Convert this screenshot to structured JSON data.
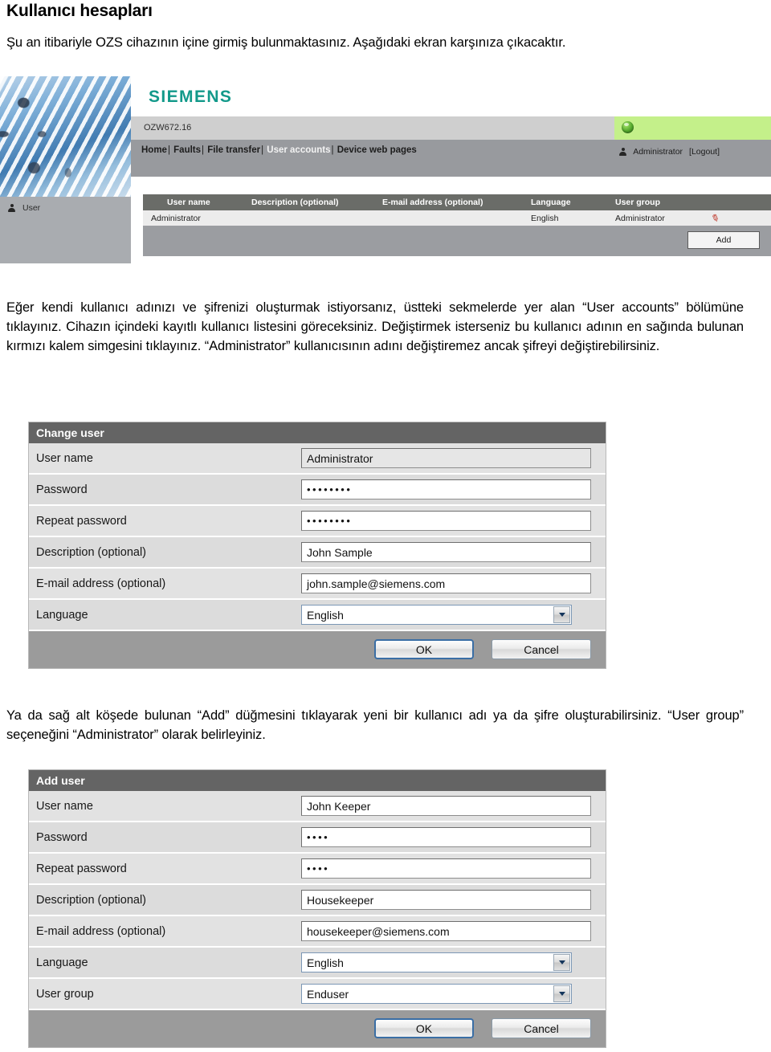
{
  "document": {
    "title": "Kullanıcı hesapları",
    "intro_paragraph": "Şu an itibariyle OZS cihazının içine girmiş bulunmaktasınız. Aşağıdaki ekran karşınıza çıkacaktır.",
    "middle_paragraph": "Eğer kendi kullanıcı adınızı ve şifrenizi oluşturmak istiyorsanız, üstteki sekmelerde yer alan “User accounts” bölümüne tıklayınız. Cihazın içindeki kayıtlı kullanıcı listesini göreceksiniz. Değiştirmek isterseniz bu kullanıcı adının en sağında bulunan kırmızı kalem simgesini tıklayınız. “Administrator” kullanıcısının adını değiştiremez ancak şifreyi değiştirebilirsiniz.",
    "add_paragraph": "Ya da sağ alt köşede bulunan “Add” düğmesini tıklayarak yeni bir kullanıcı adı ya da şifre oluşturabilirsiniz. “User group” seçeneğini “Administrator” olarak belirleyiniz."
  },
  "web_screenshot": {
    "brand": "SIEMENS",
    "device_name": "OZW672.16",
    "status_led": "green-status-led",
    "nav": {
      "items": [
        {
          "label": "Home",
          "active": false
        },
        {
          "label": "Faults",
          "active": false
        },
        {
          "label": "File transfer",
          "active": false
        },
        {
          "label": "User accounts",
          "active": true
        },
        {
          "label": "Device web pages",
          "active": false
        }
      ],
      "separator": "|"
    },
    "session": {
      "user": "Administrator",
      "logout": "[Logout]"
    },
    "sidebar": {
      "label": "User"
    },
    "users_table": {
      "headers": [
        "User name",
        "Description (optional)",
        "E-mail address (optional)",
        "Language",
        "User group"
      ],
      "rows": [
        {
          "user_name": "Administrator",
          "description": "",
          "email": "",
          "language": "English",
          "user_group": "Administrator",
          "edit_icon": "red-pen-icon"
        }
      ],
      "add_button": "Add"
    }
  },
  "change_user_dialog": {
    "title": "Change user",
    "fields": [
      {
        "label": "User name",
        "value": "Administrator",
        "type": "text",
        "readonly": true
      },
      {
        "label": "Password",
        "value": "••••••••",
        "type": "password",
        "readonly": false
      },
      {
        "label": "Repeat password",
        "value": "••••••••",
        "type": "password",
        "readonly": false
      },
      {
        "label": "Description (optional)",
        "value": "John Sample",
        "type": "text",
        "readonly": false
      },
      {
        "label": "E-mail address (optional)",
        "value": "john.sample@siemens.com",
        "type": "text",
        "readonly": false
      },
      {
        "label": "Language",
        "value": "English",
        "type": "select",
        "readonly": false
      }
    ],
    "ok_label": "OK",
    "cancel_label": "Cancel"
  },
  "add_user_dialog": {
    "title": "Add user",
    "fields": [
      {
        "label": "User name",
        "value": "John Keeper",
        "type": "text",
        "readonly": false
      },
      {
        "label": "Password",
        "value": "••••",
        "type": "password",
        "readonly": false
      },
      {
        "label": "Repeat password",
        "value": "••••",
        "type": "password",
        "readonly": false
      },
      {
        "label": "Description (optional)",
        "value": "Housekeeper",
        "type": "text",
        "readonly": false
      },
      {
        "label": "E-mail address (optional)",
        "value": "housekeeper@siemens.com",
        "type": "text",
        "readonly": false
      },
      {
        "label": "Language",
        "value": "English",
        "type": "select",
        "readonly": false
      },
      {
        "label": "User group",
        "value": "Enduser",
        "type": "select",
        "readonly": false
      }
    ],
    "ok_label": "OK",
    "cancel_label": "Cancel"
  },
  "colors": {
    "siemens_teal": "#12998a",
    "status_green": "#c4f08a",
    "dialog_title_gray": "#646464",
    "table_header_gray": "#6a6c68",
    "pen_red": "#c0392b"
  }
}
